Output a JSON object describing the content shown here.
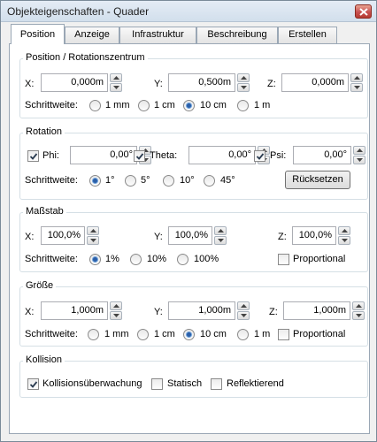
{
  "window": {
    "title": "Objekteigenschaften - Quader"
  },
  "tabs": [
    "Position",
    "Anzeige",
    "Infrastruktur",
    "Beschreibung",
    "Erstellen"
  ],
  "position_group": {
    "title": "Position / Rotationszentrum",
    "x_label": "X:",
    "x_value": "0,000m",
    "y_label": "Y:",
    "y_value": "0,500m",
    "z_label": "Z:",
    "z_value": "0,000m",
    "step_label": "Schrittweite:",
    "steps": [
      "1 mm",
      "1 cm",
      "10 cm",
      "1 m"
    ],
    "selected_step": "10 cm"
  },
  "rotation_group": {
    "title": "Rotation",
    "phi_label": "Phi:",
    "phi_value": "0,00°",
    "phi_checked": true,
    "theta_label": "Theta:",
    "theta_value": "0,00°",
    "theta_checked": true,
    "psi_label": "Psi:",
    "psi_value": "0,00°",
    "psi_checked": true,
    "step_label": "Schrittweite:",
    "steps": [
      "1°",
      "5°",
      "10°",
      "45°"
    ],
    "selected_step": "1°",
    "reset_label": "Rücksetzen"
  },
  "scale_group": {
    "title": "Maßstab",
    "x_label": "X:",
    "x_value": "100,0%",
    "y_label": "Y:",
    "y_value": "100,0%",
    "z_label": "Z:",
    "z_value": "100,0%",
    "step_label": "Schrittweite:",
    "steps": [
      "1%",
      "10%",
      "100%"
    ],
    "selected_step": "1%",
    "proportional_label": "Proportional",
    "proportional_checked": false
  },
  "size_group": {
    "title": "Größe",
    "x_label": "X:",
    "x_value": "1,000m",
    "y_label": "Y:",
    "y_value": "1,000m",
    "z_label": "Z:",
    "z_value": "1,000m",
    "step_label": "Schrittweite:",
    "steps": [
      "1 mm",
      "1 cm",
      "10 cm",
      "1 m"
    ],
    "selected_step": "10 cm",
    "proportional_label": "Proportional",
    "proportional_checked": false
  },
  "collision_group": {
    "title": "Kollision",
    "items": [
      "Kollisionsüberwachung",
      "Statisch",
      "Reflektierend"
    ],
    "checked": [
      true,
      false,
      false
    ]
  },
  "colors": {
    "radio_selected": "#2b5fa8",
    "close_button": "#c75050",
    "tab_border": "#9aa7b5"
  }
}
